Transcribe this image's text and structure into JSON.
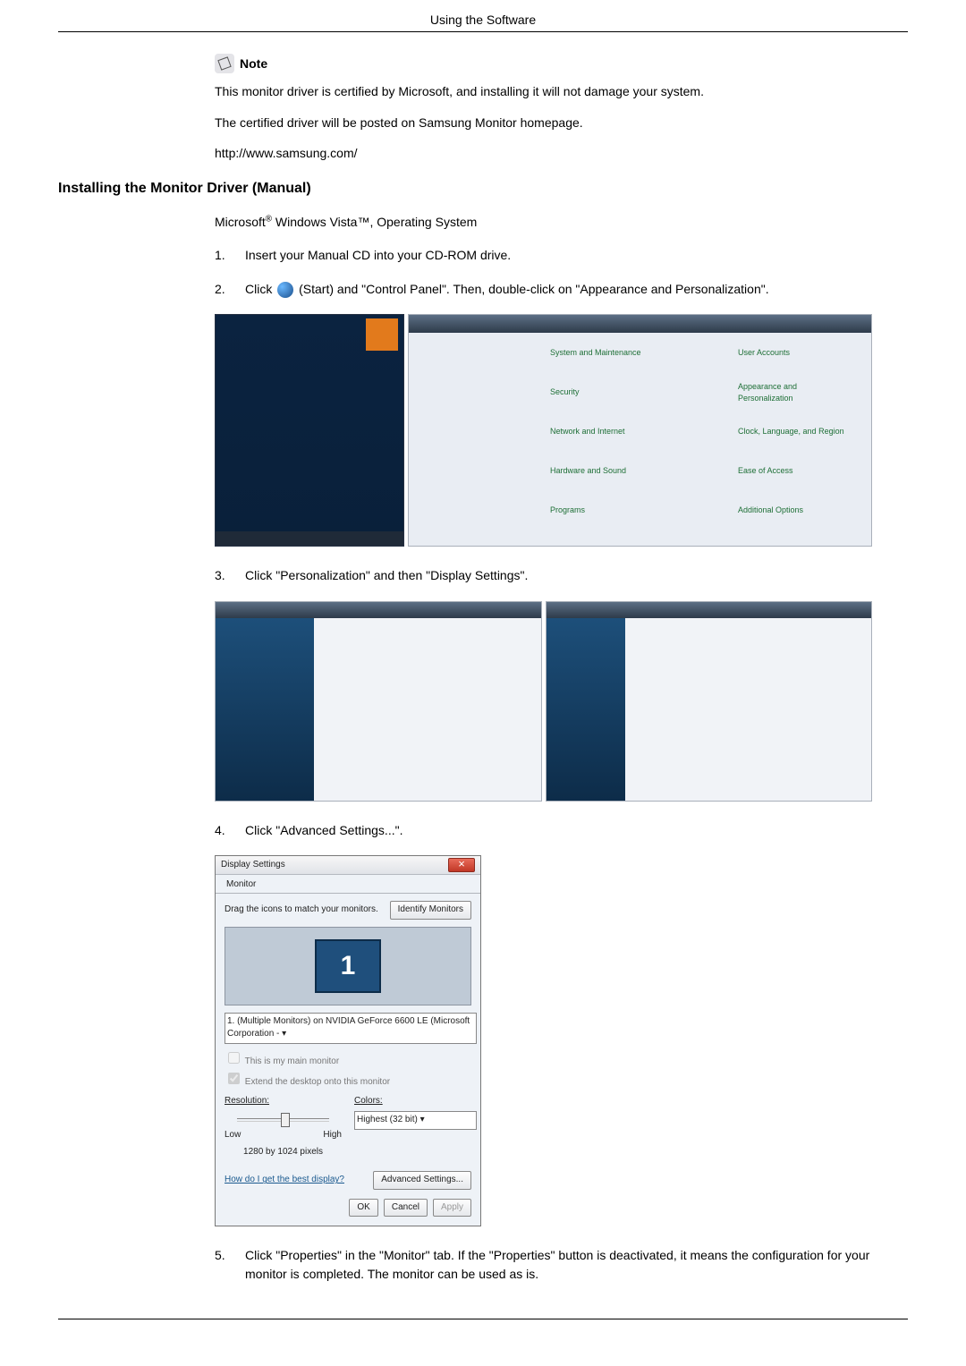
{
  "header": {
    "title": "Using the Software"
  },
  "note": {
    "label": "Note",
    "line1": "This monitor driver is certified by Microsoft, and installing it will not damage your system.",
    "line2": "The certified driver will be posted on Samsung Monitor homepage.",
    "line3": "http://www.samsung.com/"
  },
  "section": {
    "heading": "Installing the Monitor Driver (Manual)",
    "os_prefix": "Microsoft",
    "os_suffix": " Windows Vista™, Operating System"
  },
  "steps": {
    "s1_num": "1.",
    "s1_txt": "Insert your Manual CD into your CD-ROM drive.",
    "s2_num": "2.",
    "s2_a": "Click ",
    "s2_b": "(Start) and \"Control Panel\". Then, double-click on \"Appearance and Personalization\".",
    "s3_num": "3.",
    "s3_txt": "Click \"Personalization\" and then \"Display Settings\".",
    "s4_num": "4.",
    "s4_txt": "Click \"Advanced Settings...\".",
    "s5_num": "5.",
    "s5_txt": "Click \"Properties\" in the \"Monitor\" tab. If the \"Properties\" button is deactivated, it means the configuration for your monitor is completed. The monitor can be used as is."
  },
  "fig1": {
    "cp": {
      "system": "System and Maintenance",
      "user": "User Accounts",
      "security": "Security",
      "appearance": "Appearance and Personalization",
      "network": "Network and Internet",
      "clock": "Clock, Language, and Region",
      "hardware": "Hardware and Sound",
      "ease": "Ease of Access",
      "programs": "Programs",
      "additional": "Additional Options"
    }
  },
  "dlg": {
    "title": "Display Settings",
    "tab_monitor": "Monitor",
    "drag_text": "Drag the icons to match your monitors.",
    "identify_btn": "Identify Monitors",
    "monitor_num": "1",
    "device_line": "1. (Multiple Monitors) on NVIDIA GeForce 6600 LE (Microsoft Corporation -",
    "chk_main": "This is my main monitor",
    "chk_extend": "Extend the desktop onto this monitor",
    "res_label": "Resolution:",
    "res_low": "Low",
    "res_high": "High",
    "res_value": "1280 by 1024 pixels",
    "color_label": "Colors:",
    "color_value": "Highest (32 bit)",
    "help_link": "How do I get the best display?",
    "advanced_btn": "Advanced Settings...",
    "ok_btn": "OK",
    "cancel_btn": "Cancel",
    "apply_btn": "Apply"
  }
}
